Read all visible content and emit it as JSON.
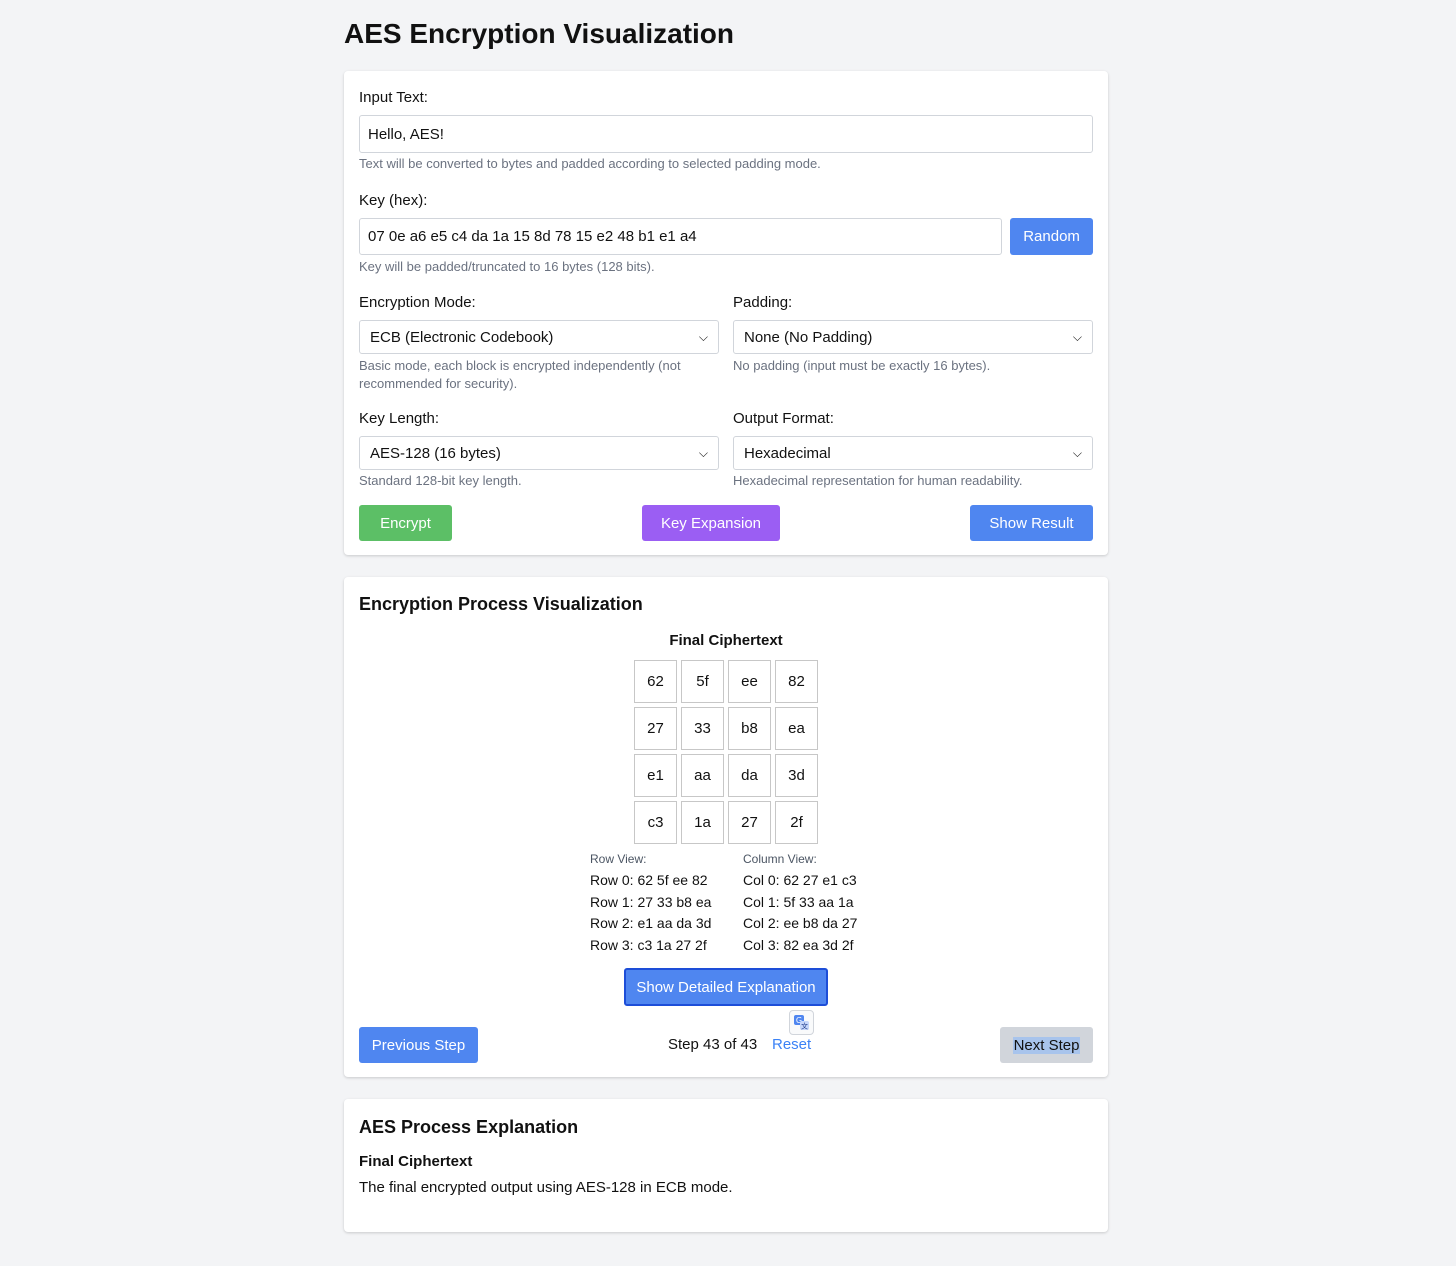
{
  "page": {
    "title": "AES Encryption Visualization"
  },
  "input_section": {
    "input_text_label": "Input Text:",
    "input_text_value": "Hello, AES!",
    "input_text_help": "Text will be converted to bytes and padded according to selected padding mode.",
    "key_label": "Key (hex):",
    "key_value": "07 0e a6 e5 c4 da 1a 15 8d 78 15 e2 48 b1 e1 a4",
    "random_button": "Random",
    "key_help": "Key will be padded/truncated to 16 bytes (128 bits).",
    "mode_label": "Encryption Mode:",
    "mode_value": "ECB (Electronic Codebook)",
    "mode_help": "Basic mode, each block is encrypted independently (not recommended for security).",
    "padding_label": "Padding:",
    "padding_value": "None (No Padding)",
    "padding_help": "No padding (input must be exactly 16 bytes).",
    "key_length_label": "Key Length:",
    "key_length_value": "AES-128 (16 bytes)",
    "key_length_help": "Standard 128-bit key length.",
    "output_format_label": "Output Format:",
    "output_format_value": "Hexadecimal",
    "output_format_help": "Hexadecimal representation for human readability.",
    "encrypt_button": "Encrypt",
    "key_expansion_button": "Key Expansion",
    "show_result_button": "Show Result"
  },
  "visualization": {
    "heading": "Encryption Process Visualization",
    "state_title": "Final Ciphertext",
    "matrix": [
      [
        "62",
        "5f",
        "ee",
        "82"
      ],
      [
        "27",
        "33",
        "b8",
        "ea"
      ],
      [
        "e1",
        "aa",
        "da",
        "3d"
      ],
      [
        "c3",
        "1a",
        "27",
        "2f"
      ]
    ],
    "row_view_label": "Row View:",
    "row_view": [
      "Row 0: 62 5f ee 82",
      "Row 1: 27 33 b8 ea",
      "Row 2: e1 aa da 3d",
      "Row 3: c3 1a 27 2f"
    ],
    "col_view_label": "Column View:",
    "col_view": [
      "Col 0: 62 27 e1 c3",
      "Col 1: 5f 33 aa 1a",
      "Col 2: ee b8 da 27",
      "Col 3: 82 ea 3d 2f"
    ],
    "show_explanation_button": "Show Detailed Explanation",
    "previous_button": "Previous Step",
    "step_counter": "Step 43 of 43",
    "reset_link": "Reset",
    "next_button": "Next Step"
  },
  "explanation": {
    "heading": "AES Process Explanation",
    "step_title": "Final Ciphertext",
    "step_text": "The final encrypted output using AES-128 in ECB mode."
  },
  "colors": {
    "primary_blue": "#4f86f0",
    "encrypt_green": "#5cbf66",
    "key_expansion_purple": "#9b5ef3",
    "page_background": "#f3f4f6"
  }
}
